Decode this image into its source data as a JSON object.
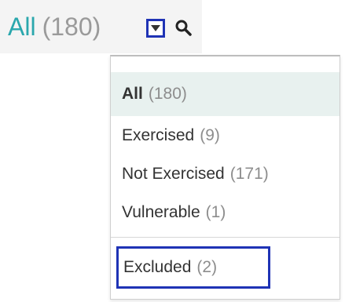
{
  "filter": {
    "selected_label": "All",
    "selected_count": "(180)"
  },
  "icons": {
    "dropdown_toggle": "caret-down-icon",
    "search": "search-icon"
  },
  "menu": {
    "items": [
      {
        "label": "All",
        "count": "(180)",
        "selected": true
      },
      {
        "label": "Exercised",
        "count": "(9)",
        "selected": false
      },
      {
        "label": "Not Exercised",
        "count": "(171)",
        "selected": false
      },
      {
        "label": "Vulnerable",
        "count": "(1)",
        "selected": false
      },
      {
        "label": "Excluded",
        "count": "(2)",
        "selected": false
      }
    ]
  },
  "colors": {
    "accent": "#2aa7ad",
    "highlight_border": "#1f33b5",
    "selected_bg": "#e8f1ef"
  }
}
